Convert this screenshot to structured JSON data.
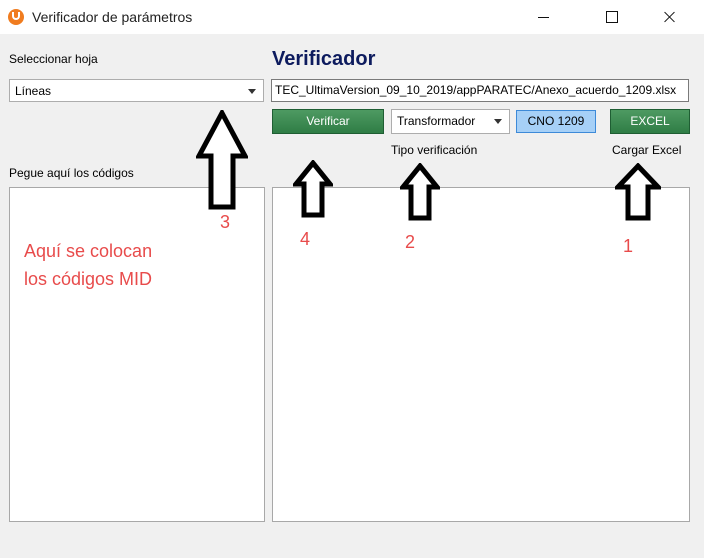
{
  "window": {
    "title": "Verificador de parámetros"
  },
  "left": {
    "sheet_label": "Seleccionar hoja",
    "sheet_value": "Líneas",
    "codes_label": "Pegue aquí los códigos"
  },
  "main": {
    "heading": "Verificador",
    "file_path": "TEC_UltimaVersion_09_10_2019/appPARATEC/Anexo_acuerdo_1209.xlsx",
    "verify_button": "Verificar",
    "type_value": "Transformador",
    "cno_button": "CNO 1209",
    "excel_button": "EXCEL",
    "type_label": "Tipo verificación",
    "load_label": "Cargar Excel"
  },
  "annotations": {
    "note_line1": "Aquí se colocan",
    "note_line2": "los códigos MID",
    "n1": "1",
    "n2": "2",
    "n3": "3",
    "n4": "4"
  },
  "colors": {
    "heading": "#0d1b5e",
    "green_button": "#2f7d45",
    "blue_button": "#a6d0f7",
    "annotation_red": "#e84b4b"
  }
}
